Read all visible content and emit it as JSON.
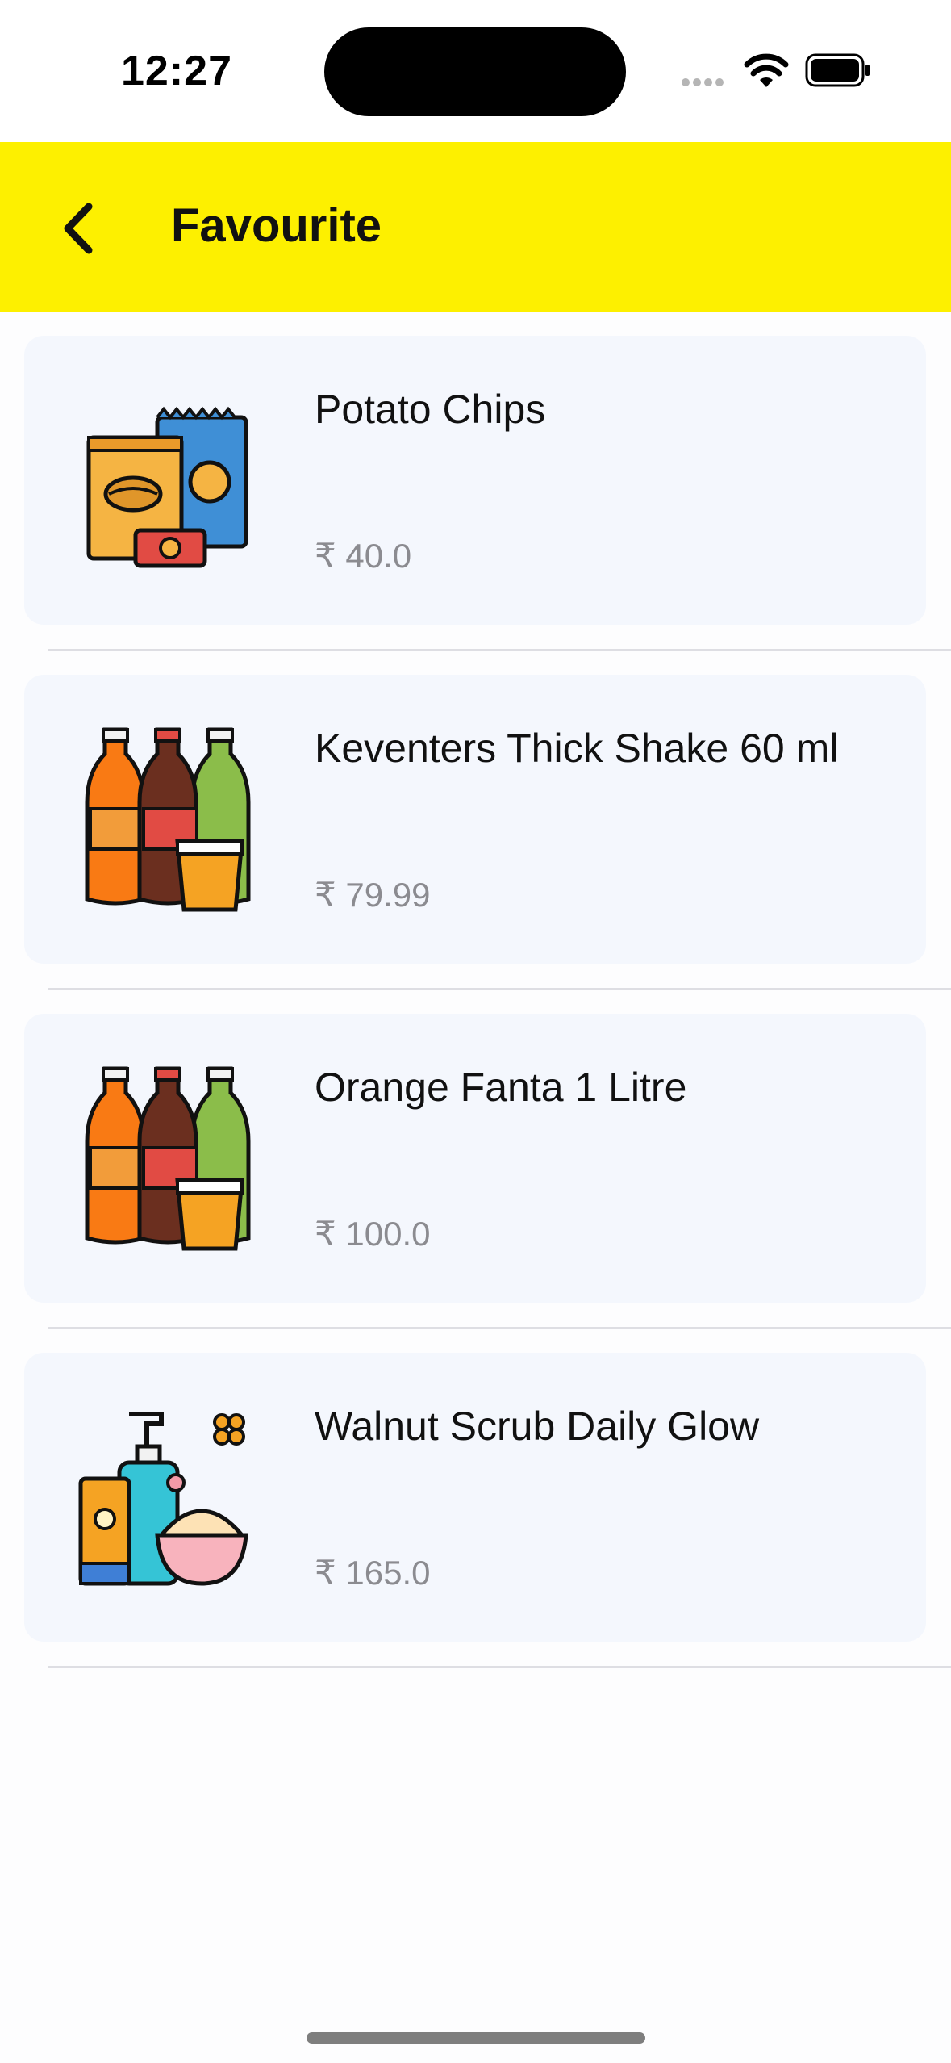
{
  "status_bar": {
    "time": "12:27"
  },
  "header": {
    "title": "Favourite"
  },
  "items": [
    {
      "name": "Potato Chips",
      "price": "₹ 40.0",
      "icon": "chips-icon"
    },
    {
      "name": "Keventers Thick Shake 60 ml",
      "price": "₹ 79.99",
      "icon": "soda-bottles-icon"
    },
    {
      "name": "Orange Fanta 1 Litre",
      "price": "₹ 100.0",
      "icon": "soda-bottles-icon"
    },
    {
      "name": "Walnut Scrub Daily Glow",
      "price": "₹ 165.0",
      "icon": "cosmetics-icon"
    }
  ],
  "colors": {
    "header_bg": "#fdf000",
    "card_bg": "#f4f7fd",
    "price_text": "#8b8b90"
  }
}
